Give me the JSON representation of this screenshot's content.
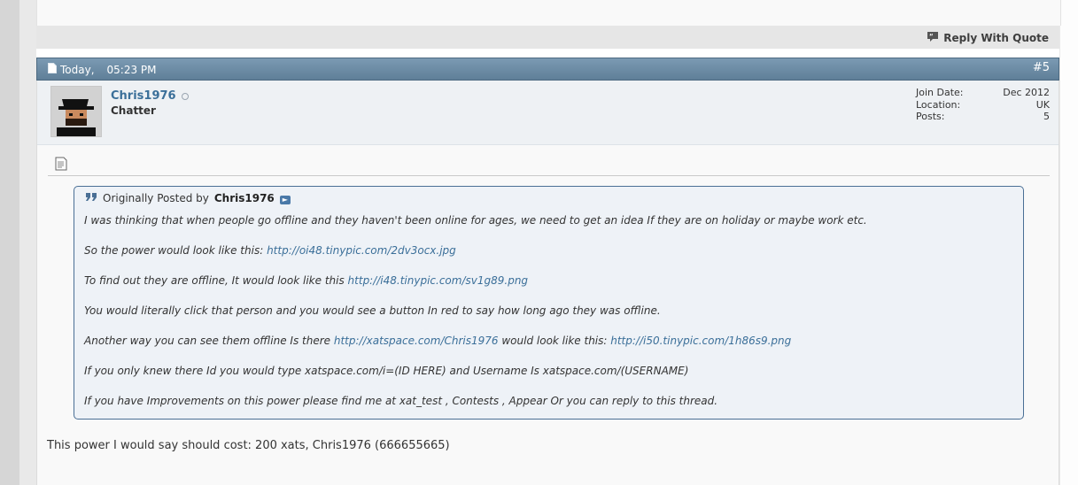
{
  "reply_with_quote_label": "Reply With Quote",
  "post": {
    "date": "Today,",
    "time": "05:23 PM",
    "number": "#5"
  },
  "user": {
    "name": "Chris1976",
    "title": "Chatter",
    "stats": [
      {
        "label": "Join Date:",
        "value": "Dec 2012"
      },
      {
        "label": "Location:",
        "value": "UK"
      },
      {
        "label": "Posts:",
        "value": "5"
      }
    ]
  },
  "quote": {
    "prefix": "Originally Posted by",
    "author": "Chris1976",
    "lines": [
      {
        "text": "I was thinking that when people go offline and they haven't been online for ages, we need to get an idea If they are on holiday or maybe work etc."
      },
      {
        "text": "So the power would look like this:",
        "link": "http://oi48.tinypic.com/2dv3ocx.jpg"
      },
      {
        "text": "To find out they are offline, It would look like this",
        "link": "http://i48.tinypic.com/sv1g89.png"
      },
      {
        "text": "You would literally click that person and you would see a button In red to say how long ago they was offline."
      },
      {
        "text": "Another way you can see them offline Is there",
        "link": "http://xatspace.com/Chris1976",
        "text2": "would look like this:",
        "link2": "http://i50.tinypic.com/1h86s9.png"
      },
      {
        "text": "If you only knew there Id you would type xatspace.com/i=(ID HERE) and Username Is xatspace.com/(USERNAME)"
      },
      {
        "text": "If you have Improvements on this power please find me at xat_test , Contests , Appear Or you can reply to this thread."
      }
    ]
  },
  "post_text": "This power I would say should cost: 200 xats, Chris1976 (666655665)",
  "colors": {
    "header_bar": "#6f8ea8",
    "link": "#3b6f99",
    "quote_border": "#4a6f95"
  }
}
